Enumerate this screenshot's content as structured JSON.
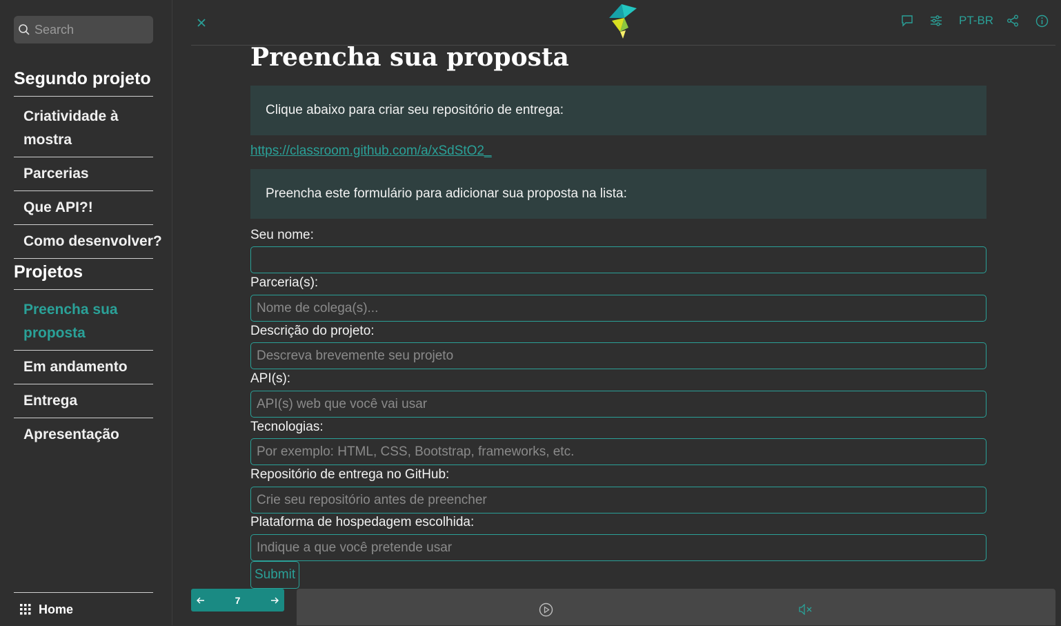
{
  "search": {
    "placeholder": "Search"
  },
  "sidebar": {
    "sections": [
      {
        "title": "Segundo projeto",
        "items": [
          {
            "label": "Criatividade à mostra"
          },
          {
            "label": "Parcerias"
          },
          {
            "label": "Que API?!"
          },
          {
            "label": "Como desenvolver?"
          }
        ]
      },
      {
        "title": "Projetos",
        "items": [
          {
            "label": "Preencha sua proposta",
            "active": true
          },
          {
            "label": "Em andamento"
          },
          {
            "label": "Entrega"
          },
          {
            "label": "Apresentação"
          }
        ]
      }
    ],
    "home_label": "Home"
  },
  "topbar": {
    "language": "PT-BR"
  },
  "main": {
    "title": "Preencha sua proposta",
    "callout1": "Clique abaixo para criar seu repositório de entrega:",
    "link": "https://classroom.github.com/a/xSdStO2_",
    "callout2": "Preencha este formulário para adicionar sua proposta na lista:",
    "form": {
      "fields": [
        {
          "label": "Seu nome:",
          "placeholder": ""
        },
        {
          "label": "Parceria(s):",
          "placeholder": "Nome de colega(s)..."
        },
        {
          "label": "Descrição do projeto:",
          "placeholder": "Descreva brevemente seu projeto"
        },
        {
          "label": "API(s):",
          "placeholder": "API(s) web que você vai usar"
        },
        {
          "label": "Tecnologias:",
          "placeholder": "Por exemplo: HTML, CSS, Bootstrap, frameworks, etc."
        },
        {
          "label": "Repositório de entrega no GitHub:",
          "placeholder": "Crie seu repositório antes de preencher"
        },
        {
          "label": "Plataforma de hospedagem escolhida:",
          "placeholder": "Indique a que você pretende usar"
        }
      ],
      "submit_label": "Submit"
    }
  },
  "pager": {
    "page": "7",
    "prev_icon": "arrow-left-icon",
    "next_icon": "arrow-right-icon"
  },
  "colors": {
    "accent": "#2aa198",
    "callout_bg": "#2f4040",
    "page_bg": "#2f2f2f"
  }
}
